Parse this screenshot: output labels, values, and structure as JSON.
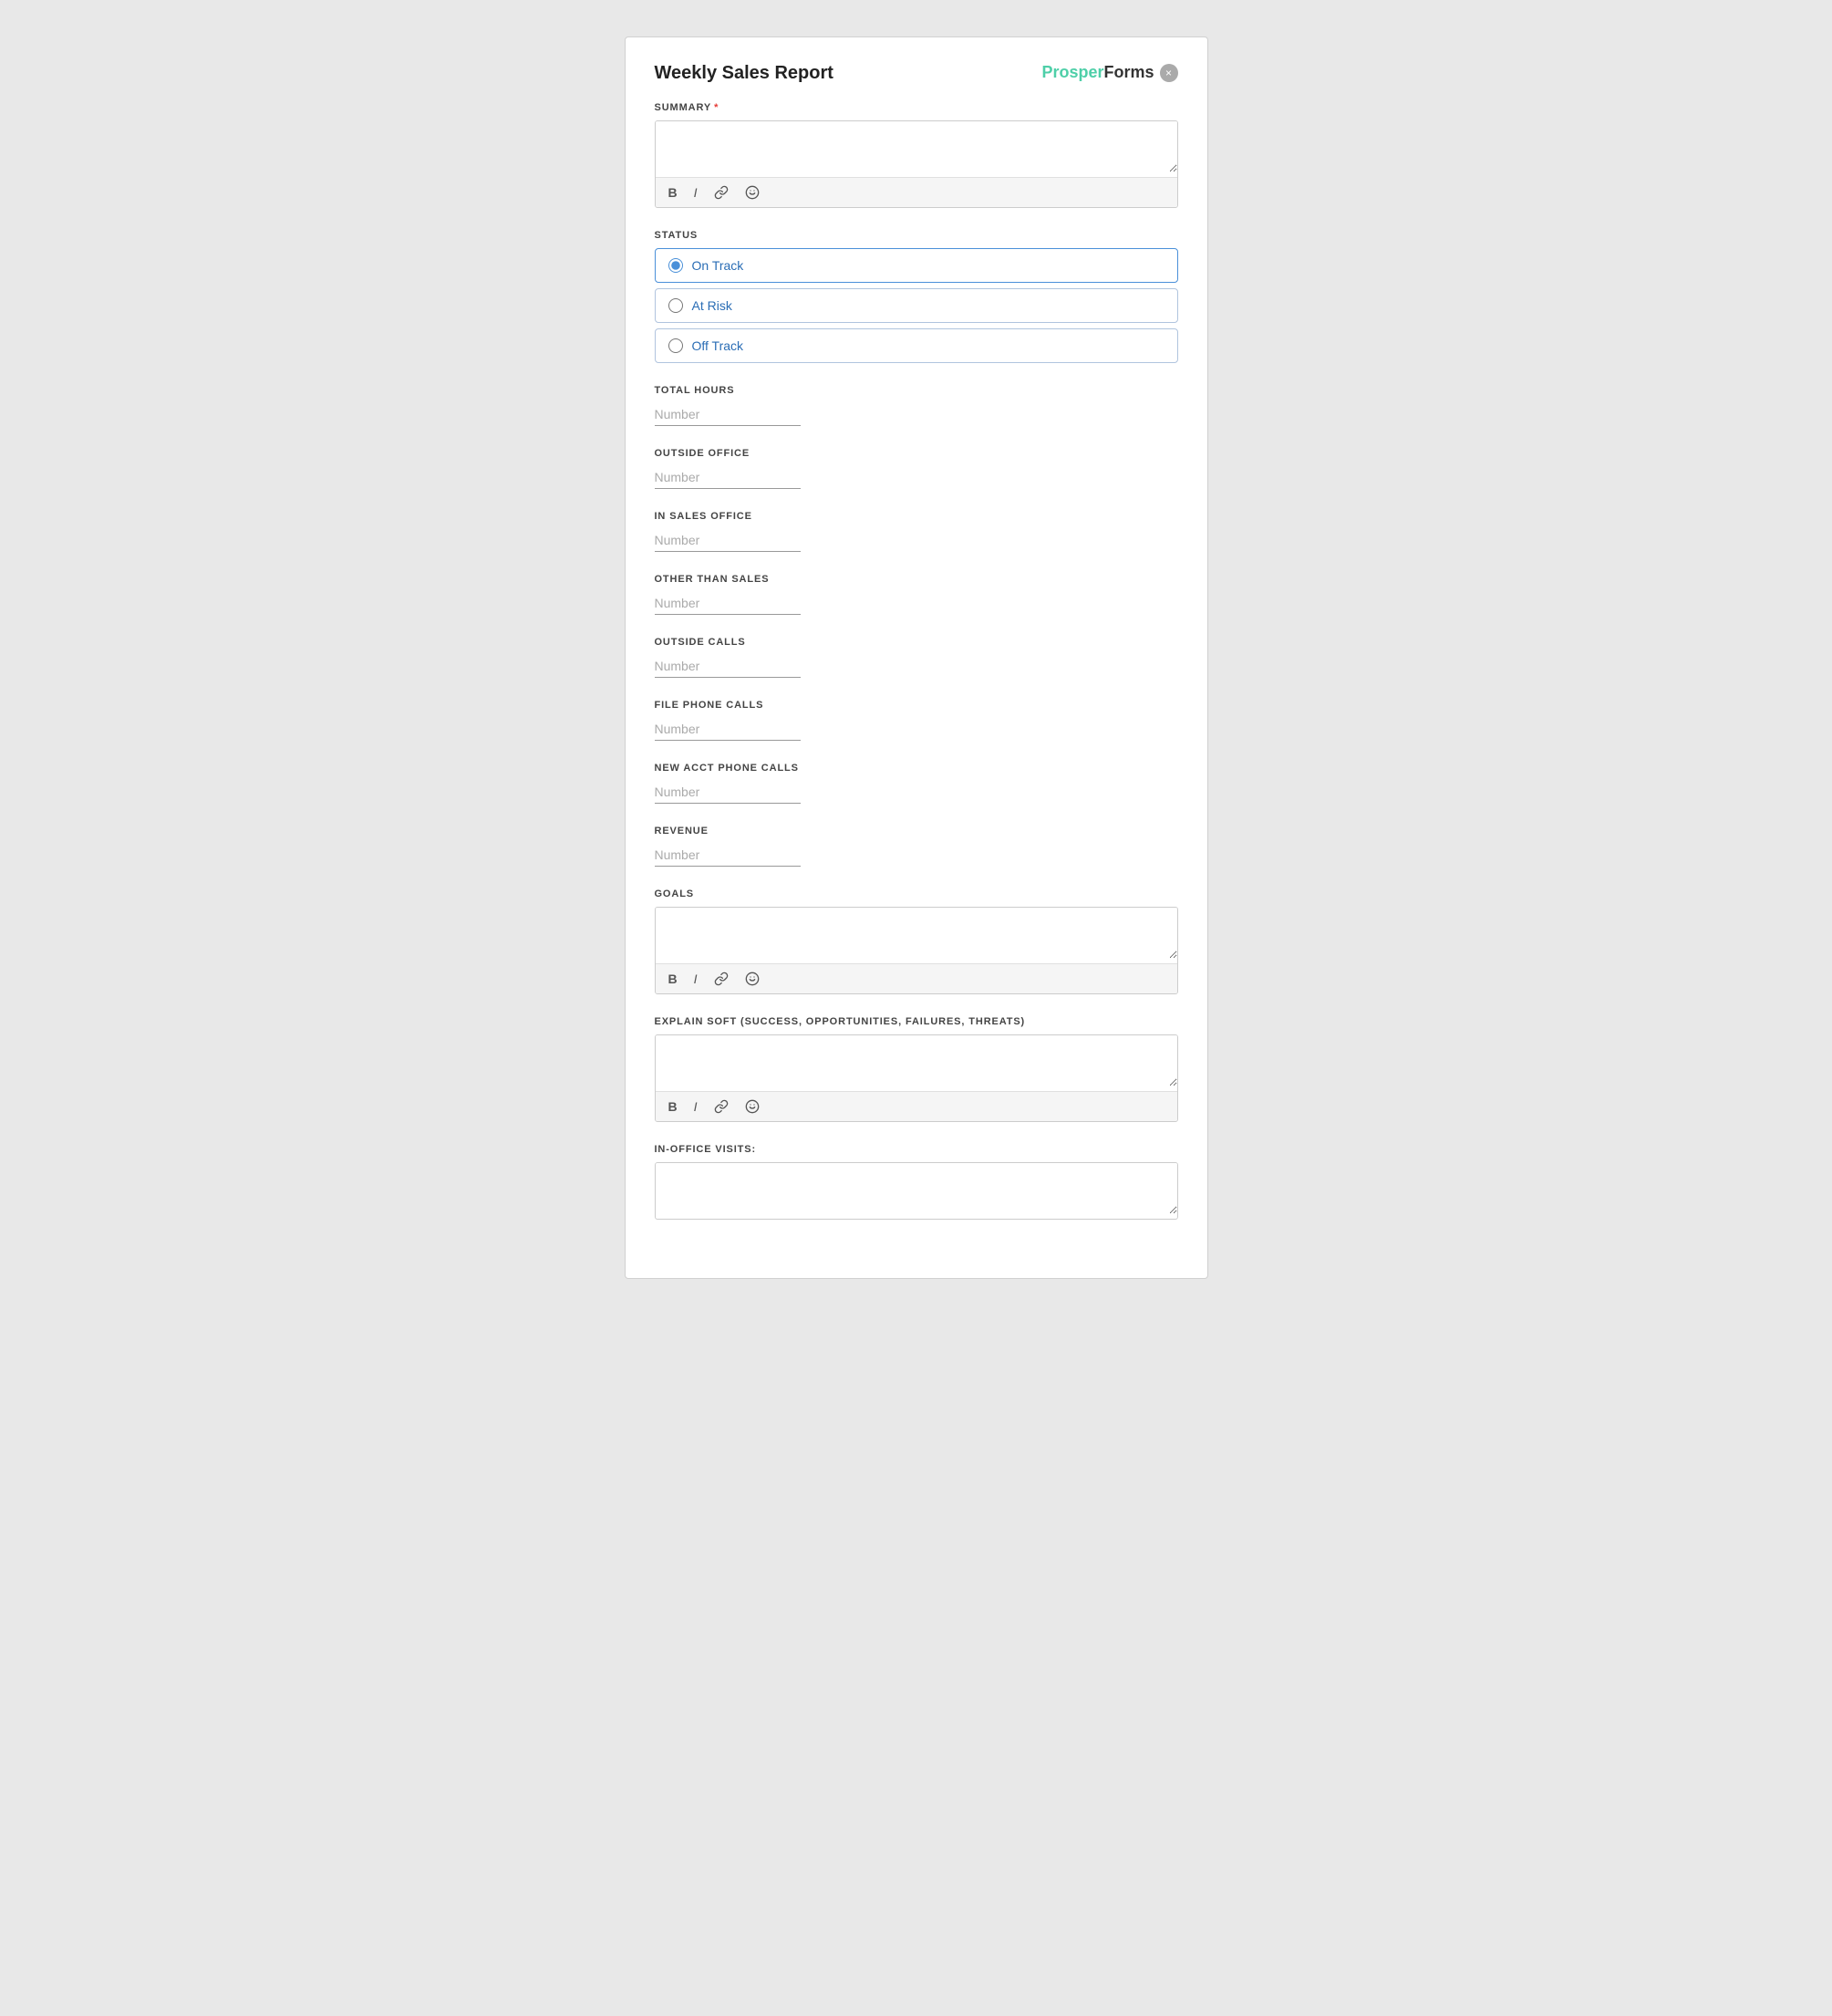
{
  "page": {
    "title": "Weekly Sales Report",
    "brand": {
      "prosper": "Prosper",
      "forms": "Forms"
    }
  },
  "sections": {
    "summary": {
      "label": "SUMMARY",
      "required": true,
      "placeholder": ""
    },
    "status": {
      "label": "STATUS",
      "options": [
        {
          "id": "on-track",
          "label": "On Track",
          "checked": true
        },
        {
          "id": "at-risk",
          "label": "At Risk",
          "checked": false
        },
        {
          "id": "off-track",
          "label": "Off Track",
          "checked": false
        }
      ]
    },
    "total_hours": {
      "label": "TOTAL HOURS",
      "placeholder": "Number"
    },
    "outside_office": {
      "label": "OUTSIDE OFFICE",
      "placeholder": "Number"
    },
    "in_sales_office": {
      "label": "IN SALES OFFICE",
      "placeholder": "Number"
    },
    "other_than_sales": {
      "label": "OTHER THAN SALES",
      "placeholder": "Number"
    },
    "outside_calls": {
      "label": "OUTSIDE CALLS",
      "placeholder": "Number"
    },
    "file_phone_calls": {
      "label": "FILE PHONE CALLS",
      "placeholder": "Number"
    },
    "new_acct_phone_calls": {
      "label": "NEW ACCT PHONE CALLS",
      "placeholder": "Number"
    },
    "revenue": {
      "label": "REVENUE",
      "placeholder": "Number"
    },
    "goals": {
      "label": "GOALS",
      "placeholder": ""
    },
    "explain_soft": {
      "label": "EXPLAIN SOFT (SUCCESS, OPPORTUNITIES, FAILURES, THREATS)",
      "placeholder": ""
    },
    "in_office_visits": {
      "label": "IN-OFFICE VISITS:",
      "placeholder": ""
    }
  },
  "toolbar": {
    "bold_label": "B",
    "italic_label": "I",
    "link_symbol": "🔗",
    "emoji_symbol": "🙂"
  },
  "close_btn_label": "×"
}
